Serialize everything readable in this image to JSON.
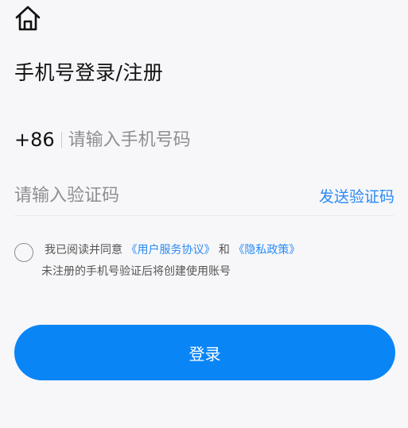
{
  "header": {
    "home_icon": "home-icon",
    "title": "手机号登录/注册"
  },
  "phone": {
    "country_code": "+86",
    "placeholder": "请输入手机号码",
    "value": ""
  },
  "verification": {
    "placeholder": "请输入验证码",
    "value": "",
    "send_label": "发送验证码"
  },
  "agreement": {
    "checked": false,
    "prefix": "我已阅读并同意",
    "user_agreement": "《用户服务协议》",
    "conjunction": "和",
    "privacy_policy": "《隐私政策》",
    "note": "未注册的手机号验证后将创建使用账号"
  },
  "login": {
    "label": "登录"
  },
  "colors": {
    "accent": "#0a85f5",
    "link": "#2a8af5",
    "background": "#f7f7f9"
  }
}
